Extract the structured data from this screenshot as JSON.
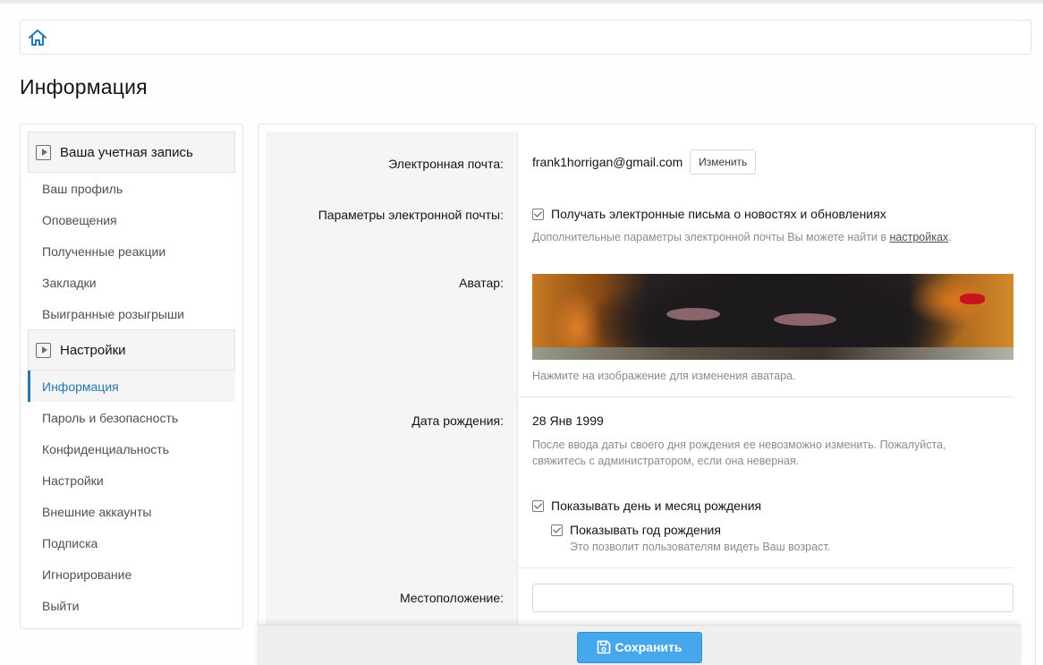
{
  "breadcrumb": {
    "home_icon": "home-icon"
  },
  "page": {
    "title": "Информация"
  },
  "sidebar": {
    "sections": [
      {
        "header": "Ваша учетная запись",
        "items": [
          "Ваш профиль",
          "Оповещения",
          "Полученные реакции",
          "Закладки",
          "Выигранные розыгрыши"
        ]
      },
      {
        "header": "Настройки",
        "items": [
          "Информация",
          "Пароль и безопасность",
          "Конфиденциальность",
          "Настройки",
          "Внешние аккаунты",
          "Подписка",
          "Игнорирование",
          "Выйти"
        ],
        "active": "Информация"
      }
    ]
  },
  "form": {
    "email": {
      "label": "Электронная почта:",
      "value": "frank1horrigan@gmail.com",
      "change_button": "Изменить"
    },
    "email_options": {
      "label": "Параметры электронной почты:",
      "checkbox_label": "Получать электронные письма о новостях и обновлениях",
      "checked": true,
      "hint_prefix": "Дополнительные параметры электронной почты Вы можете найти в ",
      "hint_link": "настройках",
      "hint_suffix": "."
    },
    "avatar": {
      "label": "Аватар:",
      "hint": "Нажмите на изображение для изменения аватара."
    },
    "birthday": {
      "label": "Дата рождения:",
      "value": "28 Янв 1999",
      "hint_line1": "После ввода даты своего дня рождения ее невозможно изменить. Пожалуйста,",
      "hint_line2": "свяжитесь с администратором, если она неверная.",
      "show_day_month": "Показывать день и месяц рождения",
      "show_year": "Показывать год рождения",
      "show_year_hint": "Это позволит пользователям видеть Ваш возраст."
    },
    "location": {
      "label": "Местоположение:",
      "value": ""
    }
  },
  "footer": {
    "save_label": "Сохранить"
  },
  "colors": {
    "accent": "#2577b1",
    "save_button": "#47a7eb",
    "label_bg": "#f5f5f5"
  }
}
